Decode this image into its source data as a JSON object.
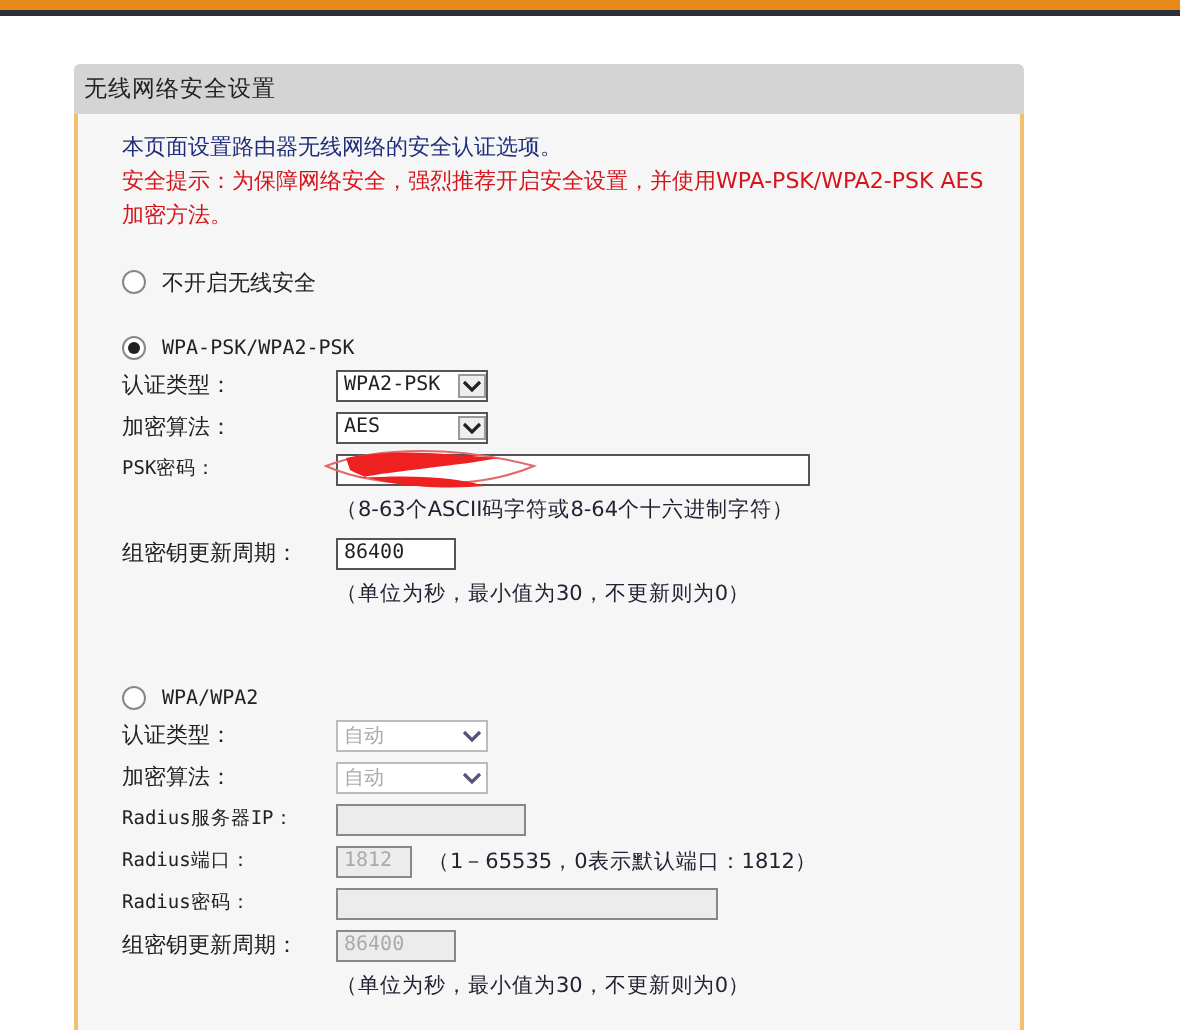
{
  "panel": {
    "title": "无线网络安全设置",
    "intro": "本页面设置路由器无线网络的安全认证选项。",
    "warning": "安全提示：为保障网络安全，强烈推荐开启安全设置，并使用WPA-PSK/WPA2-PSK AES加密方法。"
  },
  "options": [
    {
      "label": "不开启无线安全",
      "selected": false
    },
    {
      "label": "WPA-PSK/WPA2-PSK",
      "selected": true,
      "disabled": false,
      "fields": [
        {
          "kind": "select",
          "label": "认证类型：",
          "value": "WPA2-PSK"
        },
        {
          "kind": "select",
          "label": "加密算法：",
          "value": "AES"
        },
        {
          "kind": "password",
          "label": "PSK密码：",
          "redacted": true
        },
        {
          "kind": "note",
          "text": "（8-63个ASCII码字符或8-64个十六进制字符）"
        },
        {
          "kind": "period",
          "label": "组密钥更新周期：",
          "value": "86400"
        },
        {
          "kind": "note",
          "text": "（单位为秒，最小值为30，不更新则为0）"
        }
      ]
    },
    {
      "label": "WPA/WPA2",
      "selected": false,
      "disabled": true,
      "fields": [
        {
          "kind": "select",
          "label": "认证类型：",
          "value": "自动"
        },
        {
          "kind": "select",
          "label": "加密算法：",
          "value": "自动"
        },
        {
          "kind": "ip",
          "label": "Radius服务器IP："
        },
        {
          "kind": "port",
          "label": "Radius端口：",
          "value": "1812",
          "note": "（1－65535，0表示默认端口：1812）"
        },
        {
          "kind": "secret",
          "label": "Radius密码："
        },
        {
          "kind": "period",
          "label": "组密钥更新周期：",
          "value": "86400"
        },
        {
          "kind": "note",
          "text": "（单位为秒，最小值为30，不更新则为0）"
        }
      ]
    }
  ]
}
